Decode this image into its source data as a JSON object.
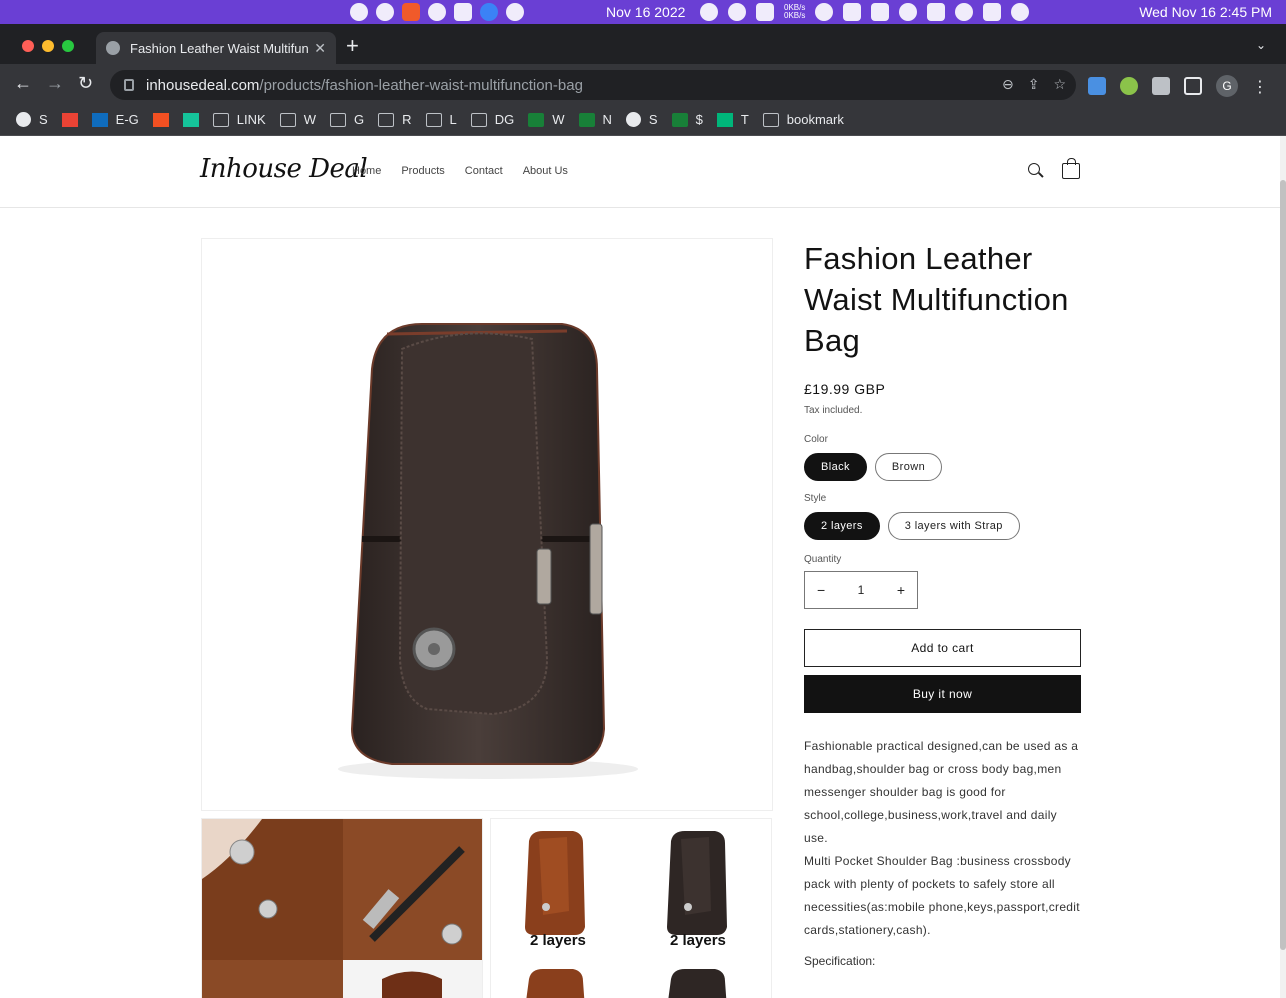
{
  "menubar": {
    "date": "Nov 16 2022",
    "net_up": "0KB/s",
    "net_down": "0KB/s",
    "clock": "Wed Nov 16  2:45 PM"
  },
  "browser": {
    "tab_title": "Fashion Leather Waist Multifunction Bag",
    "url_host": "inhousedeal.com",
    "url_path": "/products/fashion-leather-waist-multifunction-bag",
    "profile_initial": "G",
    "bookmarks": [
      {
        "icon": "globe-icon",
        "label": "S"
      },
      {
        "icon": "gmail-icon",
        "label": ""
      },
      {
        "icon": "outlook-icon",
        "label": "E-G"
      },
      {
        "icon": "microsoft-icon",
        "label": ""
      },
      {
        "icon": "grammarly-icon",
        "label": ""
      },
      {
        "icon": "folder-icon",
        "label": "LINK"
      },
      {
        "icon": "folder-icon",
        "label": "W"
      },
      {
        "icon": "folder-icon",
        "label": "G"
      },
      {
        "icon": "folder-icon",
        "label": "R"
      },
      {
        "icon": "folder-icon",
        "label": "L"
      },
      {
        "icon": "folder-icon",
        "label": "DG"
      },
      {
        "icon": "sheets-icon",
        "label": "W"
      },
      {
        "icon": "sheets-icon",
        "label": "N"
      },
      {
        "icon": "globe-icon",
        "label": "S"
      },
      {
        "icon": "sheets-icon",
        "label": "$"
      },
      {
        "icon": "star-icon",
        "label": "T"
      },
      {
        "icon": "folder-icon",
        "label": "bookmark"
      }
    ]
  },
  "site": {
    "logo": "Inhouse Deal",
    "nav": [
      "Home",
      "Products",
      "Contact",
      "About Us"
    ]
  },
  "product": {
    "title": "Fashion Leather Waist Multifunction Bag",
    "price": "£19.99 GBP",
    "tax_note": "Tax included.",
    "color_label": "Color",
    "colors": [
      "Black",
      "Brown"
    ],
    "selected_color": "Black",
    "style_label": "Style",
    "styles": [
      "2 layers",
      "3 layers with Strap"
    ],
    "selected_style": "2 layers",
    "quantity_label": "Quantity",
    "quantity": "1",
    "add_to_cart": "Add to cart",
    "buy_now": "Buy it now",
    "description": [
      "Fashionable practical designed,can be used as a handbag,shoulder bag or cross body bag,men messenger shoulder bag is good for school,college,business,work,travel and daily use.",
      "Multi Pocket Shoulder Bag :business crossbody pack with plenty of pockets to safely store all necessities(as:mobile phone,keys,passport,credit cards,stationery,cash)."
    ],
    "spec_heading": "Specification:",
    "thumb_labels": [
      "2 layers",
      "2 layers"
    ]
  },
  "colors": {
    "menubar_bg": "#6a3fd4",
    "chrome_dark": "#202124",
    "chrome_toolbar": "#35363a",
    "button_dark": "#121212",
    "leather_dark": "#3b302c",
    "leather_brown": "#8a4a26"
  }
}
